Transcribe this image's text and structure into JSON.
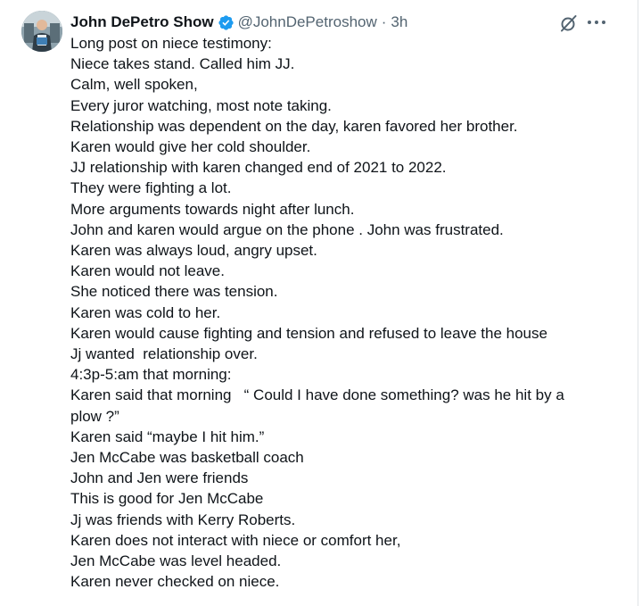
{
  "colors": {
    "text": "#0f1419",
    "secondary": "#536471",
    "verified": "#1d9bf0"
  },
  "tweet": {
    "author_name": "John DePetro Show",
    "handle": "@JohnDePetroshow",
    "separator": "·",
    "time": "3h",
    "icons": {
      "avatar": "profile-avatar",
      "verified": "verified-badge-icon",
      "grok": "grok-icon",
      "more": "more-options-icon"
    },
    "lines": [
      "Long post on niece testimony:",
      "Niece takes stand. Called him JJ.",
      "Calm, well spoken,",
      "Every juror watching, most note taking.",
      "Relationship was dependent on the day, karen favored her brother.",
      "Karen would give her cold shoulder.",
      "JJ relationship with karen changed end of 2021 to 2022.",
      "They were fighting a lot.",
      "More arguments towards night after lunch.",
      "John and karen would argue on the phone . John was frustrated.",
      "Karen was always loud, angry upset.",
      "Karen would not leave.",
      "She noticed there was tension.",
      "Karen was cold to her.",
      "Karen would cause fighting and tension and refused to leave the house",
      "Jj wanted  relationship over.",
      "4:3p-5:am that morning:",
      "Karen said that morning   “ Could I have done something? was he hit by a",
      "plow ?”",
      "Karen said “maybe I hit him.”",
      "Jen McCabe was basketball coach",
      "John and Jen were friends",
      "This is good for Jen McCabe",
      "Jj was friends with Kerry Roberts.",
      "Karen does not interact with niece or comfort her,",
      "Jen McCabe was level headed.",
      "Karen never checked on niece."
    ]
  }
}
